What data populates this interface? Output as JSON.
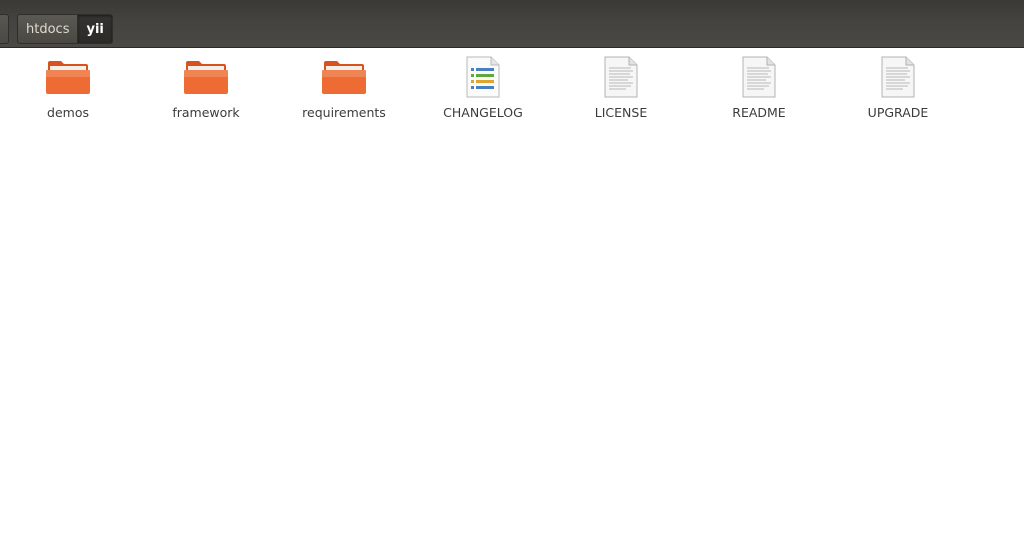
{
  "window": {
    "breadcrumb": [
      {
        "label": "htdocs"
      },
      {
        "label": "yii"
      }
    ]
  },
  "files": [
    {
      "name": "demos",
      "icon": "folder-icon",
      "type": "folder"
    },
    {
      "name": "framework",
      "icon": "folder-icon",
      "type": "folder"
    },
    {
      "name": "requirements",
      "icon": "folder-icon",
      "type": "folder"
    },
    {
      "name": "CHANGELOG",
      "icon": "changelog-document-icon",
      "type": "changelog"
    },
    {
      "name": "LICENSE",
      "icon": "text-document-icon",
      "type": "text"
    },
    {
      "name": "README",
      "icon": "text-document-icon",
      "type": "text"
    },
    {
      "name": "UPGRADE",
      "icon": "text-document-icon",
      "type": "text"
    }
  ],
  "colors": {
    "folder": "#e8602c",
    "folder_light": "#f29a6a",
    "toolbar": "#45433f",
    "breadcrumb_active": "#2e2d2a"
  }
}
